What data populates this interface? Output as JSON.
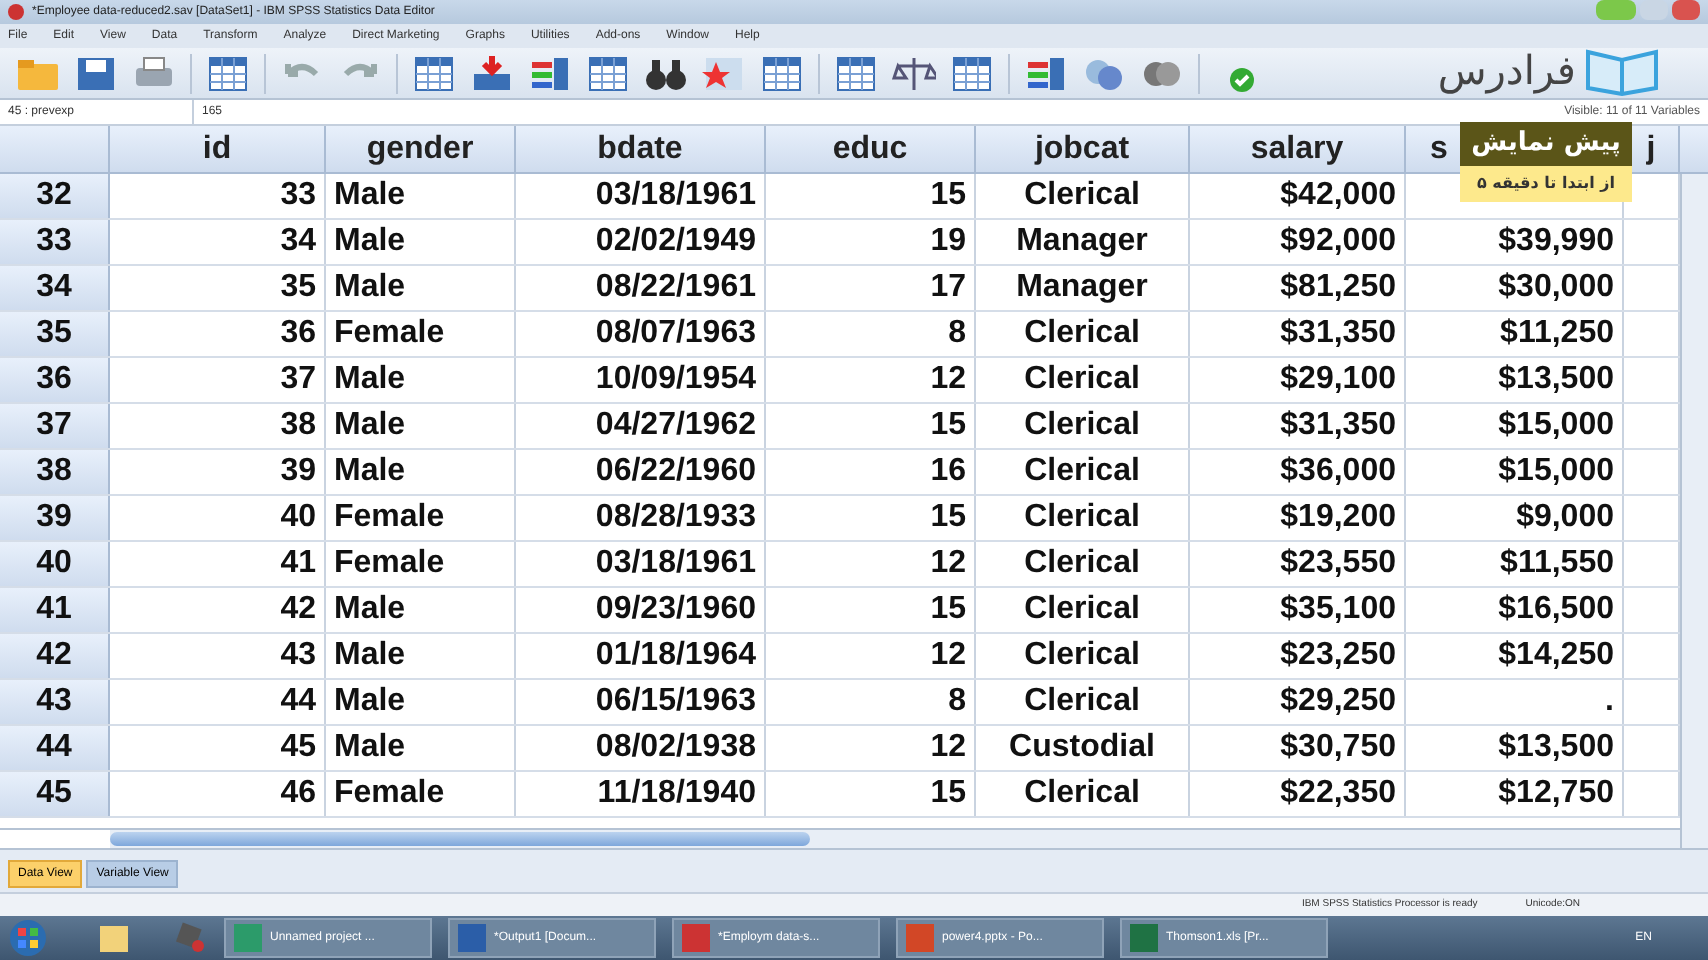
{
  "window": {
    "title": "*Employee data-reduced2.sav [DataSet1] - IBM SPSS Statistics Data Editor"
  },
  "menu": [
    "File",
    "Edit",
    "View",
    "Data",
    "Transform",
    "Analyze",
    "Direct Marketing",
    "Graphs",
    "Utilities",
    "Add-ons",
    "Window",
    "Help"
  ],
  "logo": {
    "text": "فرادرس"
  },
  "cell_editor": {
    "cell": "45 : prevexp",
    "value": "165",
    "visible": "Visible: 11 of 11 Variables"
  },
  "preview_badge": {
    "title": "پیش نمایش",
    "subtitle": "از ابتدا تا دقیقه ۵"
  },
  "table": {
    "columns": [
      "id",
      "gender",
      "bdate",
      "educ",
      "jobcat",
      "salary",
      "s",
      "j"
    ],
    "rows": [
      {
        "row": "32",
        "cells": [
          "33",
          "Male",
          "03/18/1961",
          "15",
          "Clerical",
          "$42,000",
          ""
        ]
      },
      {
        "row": "33",
        "cells": [
          "34",
          "Male",
          "02/02/1949",
          "19",
          "Manager",
          "$92,000",
          "$39,990"
        ]
      },
      {
        "row": "34",
        "cells": [
          "35",
          "Male",
          "08/22/1961",
          "17",
          "Manager",
          "$81,250",
          "$30,000"
        ]
      },
      {
        "row": "35",
        "cells": [
          "36",
          "Female",
          "08/07/1963",
          "8",
          "Clerical",
          "$31,350",
          "$11,250"
        ]
      },
      {
        "row": "36",
        "cells": [
          "37",
          "Male",
          "10/09/1954",
          "12",
          "Clerical",
          "$29,100",
          "$13,500"
        ]
      },
      {
        "row": "37",
        "cells": [
          "38",
          "Male",
          "04/27/1962",
          "15",
          "Clerical",
          "$31,350",
          "$15,000"
        ]
      },
      {
        "row": "38",
        "cells": [
          "39",
          "Male",
          "06/22/1960",
          "16",
          "Clerical",
          "$36,000",
          "$15,000"
        ]
      },
      {
        "row": "39",
        "cells": [
          "40",
          "Female",
          "08/28/1933",
          "15",
          "Clerical",
          "$19,200",
          "$9,000"
        ]
      },
      {
        "row": "40",
        "cells": [
          "41",
          "Female",
          "03/18/1961",
          "12",
          "Clerical",
          "$23,550",
          "$11,550"
        ]
      },
      {
        "row": "41",
        "cells": [
          "42",
          "Male",
          "09/23/1960",
          "15",
          "Clerical",
          "$35,100",
          "$16,500"
        ]
      },
      {
        "row": "42",
        "cells": [
          "43",
          "Male",
          "01/18/1964",
          "12",
          "Clerical",
          "$23,250",
          "$14,250"
        ]
      },
      {
        "row": "43",
        "cells": [
          "44",
          "Male",
          "06/15/1963",
          "8",
          "Clerical",
          "$29,250",
          "."
        ]
      },
      {
        "row": "44",
        "cells": [
          "45",
          "Male",
          "08/02/1938",
          "12",
          "Custodial",
          "$30,750",
          "$13,500"
        ]
      },
      {
        "row": "45",
        "cells": [
          "46",
          "Female",
          "11/18/1940",
          "15",
          "Clerical",
          "$22,350",
          "$12,750"
        ]
      }
    ]
  },
  "view_tabs": [
    {
      "label": "Data View",
      "selected": true
    },
    {
      "label": "Variable View",
      "selected": false
    }
  ],
  "status_bar": [
    "IBM SPSS Statistics Processor is ready",
    "Unicode:ON"
  ],
  "taskbar": {
    "tasks": [
      "Unnamed project ...",
      "*Output1 [Docum...",
      "*Employm data-s...",
      "power4.pptx - Po...",
      "Thomson1.xls [Pr..."
    ],
    "tray": "EN"
  }
}
